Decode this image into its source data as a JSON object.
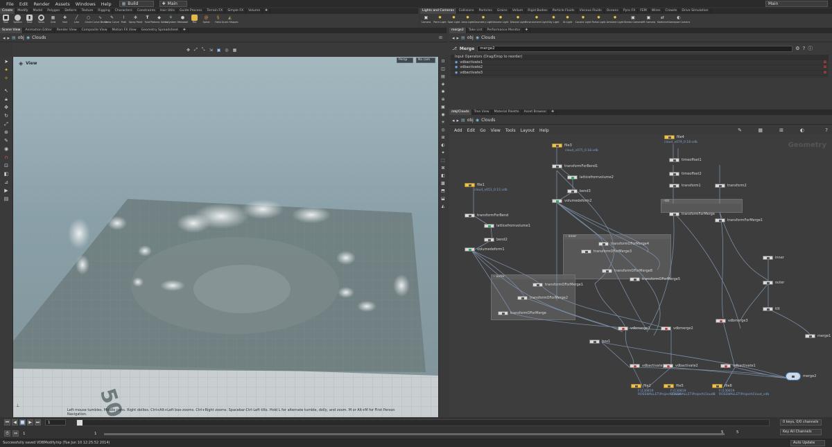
{
  "menu": [
    "File",
    "Edit",
    "Render",
    "Assets",
    "Windows",
    "Help"
  ],
  "desktop": "Build",
  "scene_tab": "Main",
  "top_right_select": "Main",
  "shelf_left": {
    "tabs": [
      "Create",
      "Modify",
      "Model",
      "Polygon",
      "Deform",
      "Texture",
      "Rigging",
      "Characters",
      "Constraints",
      "Hair Utils",
      "Guide Process",
      "Terrain FX",
      "Simple FX",
      "Volume"
    ],
    "tools": [
      "Box",
      "Sphere",
      "Tube",
      "Torus",
      "Grid",
      "Null",
      "Line",
      "Circle",
      "Curve Bezier",
      "Draw Curve",
      "Path",
      "Spray Paint",
      "Font",
      "Platonic Solids",
      "L-System",
      "Metaball",
      "File",
      "Spiral",
      "Helix",
      "Quick Shapes"
    ]
  },
  "shelf_right": {
    "tabs": [
      "Lights and Cameras",
      "Collisions",
      "Particles",
      "Grains",
      "Vellum",
      "Rigid Bodies",
      "Particle Fluids",
      "Viscous Fluids",
      "Oceans",
      "Pyro FX",
      "FEM",
      "Wires",
      "Crowds",
      "Drive Simulation"
    ],
    "tools": [
      "Camera",
      "Point Light",
      "Spot Light",
      "Area Light",
      "Geometry Light",
      "Volume Light",
      "Distant Light",
      "Environment Light",
      "Sky Light",
      "GI Light",
      "Caustic Light",
      "Portal Light",
      "Ambient Light",
      "Stereo Camera",
      "VR Camera",
      "Switcher",
      "Gamepad Camera"
    ]
  },
  "left_pane": {
    "tabs": [
      "Scene View",
      "Animation Editor",
      "Render View",
      "Composite View",
      "Motion FX View",
      "Geometry Spreadsheet"
    ],
    "path": [
      "obj",
      "Clouds"
    ],
    "viewport_title": "View",
    "persp": "Persp",
    "cam": "No cam",
    "hint": "Left mouse tumbles. Middle pans. Right dollies. Ctrl+Alt+Left box-zooms. Ctrl+Right zooms. Spacebar-Ctrl-Left tilts. Hold L for alternate tumble, dolly, and zoom. M or Alt+M for First Person Navigation.",
    "grid_number": "50"
  },
  "param_pane": {
    "tabs": [
      "merge2",
      "Take List",
      "Performance Monitor"
    ],
    "path": [
      "obj",
      "Clouds"
    ],
    "node_type": "Merge",
    "node_name": "merge2",
    "header": "Input Operators (Drag/Drop to reorder)",
    "inputs": [
      "vdbactivate1",
      "vdbactivate2",
      "vdbactivate3"
    ]
  },
  "network_pane": {
    "tabs": [
      "/obj/Clouds",
      "Tree View",
      "Material Palette",
      "Asset Browser"
    ],
    "path": [
      "obj",
      "Clouds"
    ],
    "menu": [
      "Add",
      "Edit",
      "Go",
      "View",
      "Tools",
      "Layout",
      "Help"
    ],
    "watermark": "Geometry",
    "nodes": [
      {
        "name": "file1",
        "sub": "cloud_v051_0.15.vdb",
        "type": "file"
      },
      {
        "name": "transformForBend"
      },
      {
        "name": "latticefromvolume1"
      },
      {
        "name": "bend2"
      },
      {
        "name": "volumedeform1"
      },
      {
        "name": "file3",
        "sub": "cloud_v075_0.18.vdb",
        "type": "file"
      },
      {
        "name": "transformForBend1"
      },
      {
        "name": "latticefromvolume2"
      },
      {
        "name": "bend3"
      },
      {
        "name": "volumedeform2"
      },
      {
        "name": "file4",
        "sub": "cloud_v079_0.18.vdb",
        "type": "file"
      },
      {
        "name": "timeoffset1"
      },
      {
        "name": "timeoffset2"
      },
      {
        "name": "transform1"
      },
      {
        "name": "transform2"
      },
      {
        "name": "transformForMerge"
      },
      {
        "name": "transformForMerge1"
      },
      {
        "name": "transformOForMerge4"
      },
      {
        "name": "transformOForMerge3"
      },
      {
        "name": "transformOForMerge8"
      },
      {
        "name": "transformOForMerge5"
      },
      {
        "name": "transformOForMerge1"
      },
      {
        "name": "transformOForMerge2"
      },
      {
        "name": "transformOForMerge"
      },
      {
        "name": "inner"
      },
      {
        "name": "outer"
      },
      {
        "name": "tilt"
      },
      {
        "name": "vdbmerge1"
      },
      {
        "name": "vdbmerge2"
      },
      {
        "name": "vdbmerge3"
      },
      {
        "name": "merge1"
      },
      {
        "name": "box1"
      },
      {
        "name": "vdbactivate3"
      },
      {
        "name": "vdbactivate2"
      },
      {
        "name": "vdbactivate1"
      },
      {
        "name": "merge2"
      },
      {
        "name": "file2",
        "sub": "F:\\130819 ROSSWALLET\\Project\\Cloud",
        "type": "file"
      },
      {
        "name": "file5",
        "sub": "F:\\130819 ROSSWALLET\\Project\\CloudB",
        "type": "file"
      },
      {
        "name": "file6",
        "sub": "F:\\130819 ROSSWALLET\\Project\\Cloud_vdb",
        "type": "file"
      }
    ],
    "boxes": [
      "--tilt",
      "-- inner",
      "-- outer"
    ]
  },
  "timeline": {
    "frame": "1",
    "start": "1",
    "start2": "1",
    "end": "5",
    "end2": "5",
    "keys": "0 keys, 0/0 channels",
    "key_all": "Key All Channels",
    "auto_update": "Auto Update",
    "status": "Successfully saved VDBModify.hip (Tue Jun 10 12:25:52 2014)"
  }
}
